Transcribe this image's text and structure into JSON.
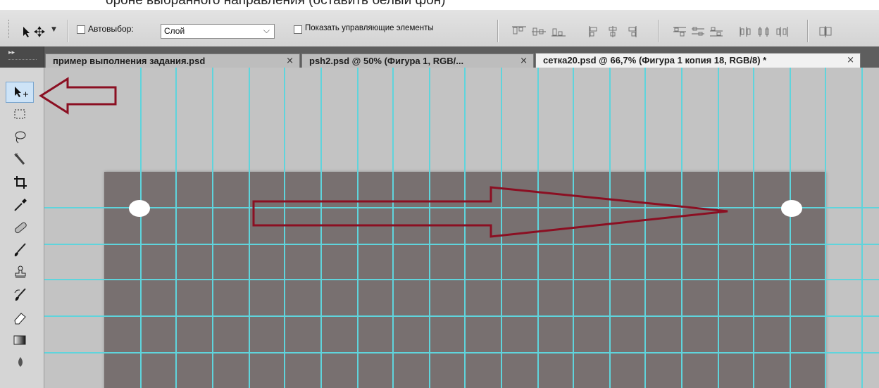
{
  "doc_snippet": "ороне выбранного направления (оставить белый фон)",
  "options_bar": {
    "tool_preset_icon": "move-tool-icon",
    "auto_select_label": "Автовыбор:",
    "auto_select_checked": false,
    "auto_select_value": "Слой",
    "show_controls_label": "Показать управляющие элементы",
    "show_controls_checked": false,
    "align_icons": [
      "align-top-icon",
      "align-vcenter-icon",
      "align-bottom-icon",
      "align-left-icon",
      "align-hcenter-icon",
      "align-right-icon"
    ],
    "distribute_icons": [
      "distribute-top-icon",
      "distribute-vcenter-icon",
      "distribute-bottom-icon",
      "distribute-left-icon",
      "distribute-hcenter-icon",
      "distribute-right-icon"
    ],
    "auto_align_icon": "auto-align-icon"
  },
  "tabs": [
    {
      "label": "пример выполнения задания.psd",
      "active": false
    },
    {
      "label": "psh2.psd @ 50% (Фигура 1, RGB/...",
      "active": false
    },
    {
      "label": "сетка20.psd @ 66,7% (Фигура 1 копия 18, RGB/8) *",
      "active": true
    }
  ],
  "tab_close": "×",
  "tools": [
    "move-tool",
    "marquee-tool",
    "lasso-tool",
    "quick-selection-tool",
    "crop-tool",
    "eyedropper-tool",
    "healing-brush-tool",
    "brush-tool",
    "clone-stamp-tool",
    "history-brush-tool",
    "eraser-tool",
    "gradient-tool"
  ],
  "colors": {
    "guide": "#5fd4dc",
    "annotation_arrow": "#8b0f22",
    "document_fill": "#787070",
    "canvas_bg": "#c3c3c3",
    "guide_dot": "#ffffff"
  }
}
